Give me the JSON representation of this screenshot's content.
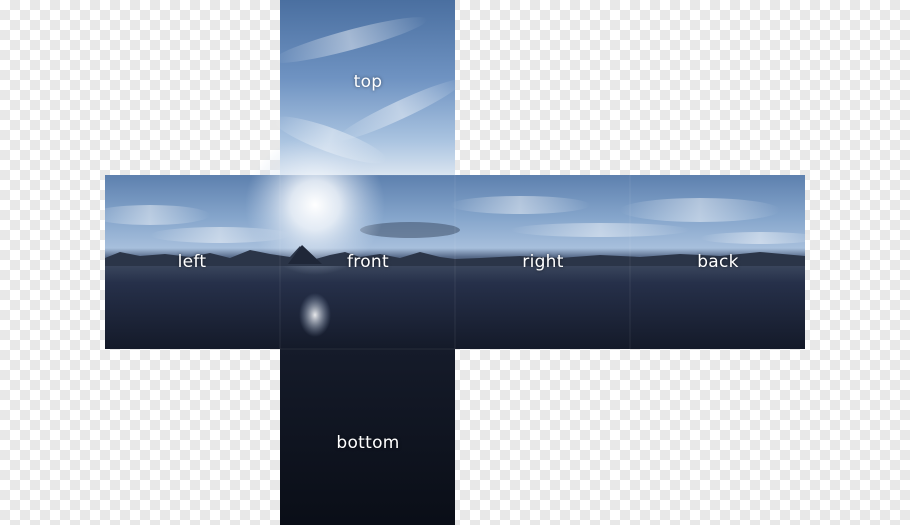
{
  "faces": {
    "top": "top",
    "left": "left",
    "front": "front",
    "right": "right",
    "back": "back",
    "bottom": "bottom"
  },
  "colors": {
    "sky_high": "#5b7fae",
    "sky_mid": "#8fb0d6",
    "horizon_glow": "#f4f7fb",
    "mountains": "#2a3446",
    "water_near": "#1e2535",
    "water_deep": "#0d111b"
  }
}
